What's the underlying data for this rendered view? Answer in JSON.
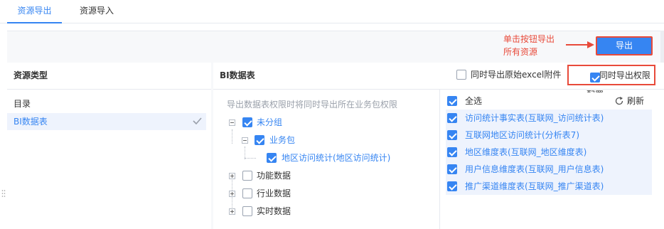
{
  "tabs": [
    {
      "label": "资源导出",
      "active": true
    },
    {
      "label": "资源导入",
      "active": false
    }
  ],
  "annotation": {
    "line1": "单击按钮导出",
    "line2": "所有资源"
  },
  "export_button": {
    "label": "导出"
  },
  "left_panel": {
    "title": "资源类型",
    "items": [
      {
        "label": "目录",
        "selected": false
      },
      {
        "label": "BI数据表",
        "selected": true
      }
    ]
  },
  "middle_panel": {
    "title": "BI数据表",
    "options": {
      "export_excel": {
        "label": "同时导出原始excel附件",
        "checked": false
      },
      "export_permissions": {
        "label": "同时导出权限配置",
        "checked": true
      }
    },
    "hint": "导出数据表权限时将同时导出所在业务包权限",
    "tree": [
      {
        "label": "未分组",
        "checked": true,
        "expanded": true
      },
      {
        "label": "业务包",
        "checked": true,
        "expanded": true
      },
      {
        "label": "地区访问统计(地区访问统计)",
        "checked": true
      },
      {
        "label": "功能数据",
        "checked": false,
        "expanded": false
      },
      {
        "label": "行业数据",
        "checked": false,
        "expanded": false
      },
      {
        "label": "实时数据",
        "checked": false,
        "expanded": false
      }
    ]
  },
  "right_list": {
    "select_all": {
      "label": "全选",
      "checked": true
    },
    "refresh_label": "刷新",
    "items": [
      {
        "label": "访问统计事实表(互联网_访问统计表)",
        "checked": true
      },
      {
        "label": "互联网地区访问统计(分析表7)",
        "checked": true
      },
      {
        "label": "地区维度表(互联网_地区维度表)",
        "checked": true
      },
      {
        "label": "用户信息维度表(互联网_用户信息表)",
        "checked": true
      },
      {
        "label": "推广渠道维度表(互联网_推广渠道表)",
        "checked": true
      }
    ]
  },
  "colors": {
    "accent": "#3685f2",
    "annotation": "#e84a3a"
  }
}
